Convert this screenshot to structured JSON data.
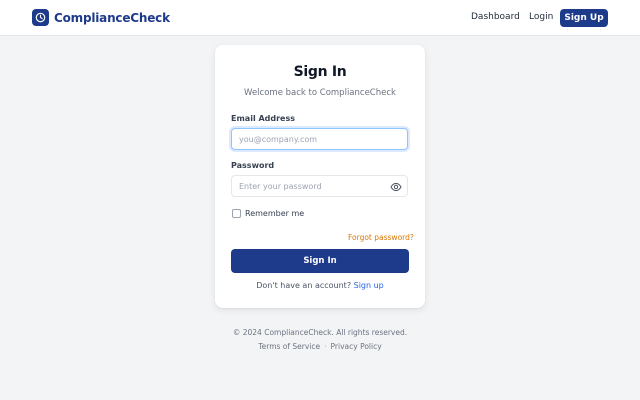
{
  "header": {
    "brand_name": "ComplianceCheck",
    "logo_icon": "clock-icon",
    "nav": {
      "dashboard": "Dashboard",
      "login": "Login",
      "signup": "Sign Up"
    }
  },
  "signin_form": {
    "title": "Sign In",
    "subtitle": "Welcome back to ComplianceCheck",
    "email": {
      "label": "Email Address",
      "placeholder": "you@company.com",
      "value": ""
    },
    "password": {
      "label": "Password",
      "placeholder": "Enter your password",
      "value": "",
      "toggle_icon": "eye-icon"
    },
    "remember_me": {
      "label": "Remember me",
      "checked": false
    },
    "forgot_password": "Forgot password?",
    "submit_label": "Sign In",
    "no_account_text": "Don't have an account?",
    "signup_link": "Sign up"
  },
  "footer": {
    "copyright": "© 2024 ComplianceCheck. All rights reserved.",
    "terms": "Terms of Service",
    "separator": "·",
    "privacy": "Privacy Policy"
  },
  "colors": {
    "brand": "#1e3a8a",
    "link": "#2563eb",
    "forgot": "#d97706",
    "background": "#f3f4f6"
  }
}
